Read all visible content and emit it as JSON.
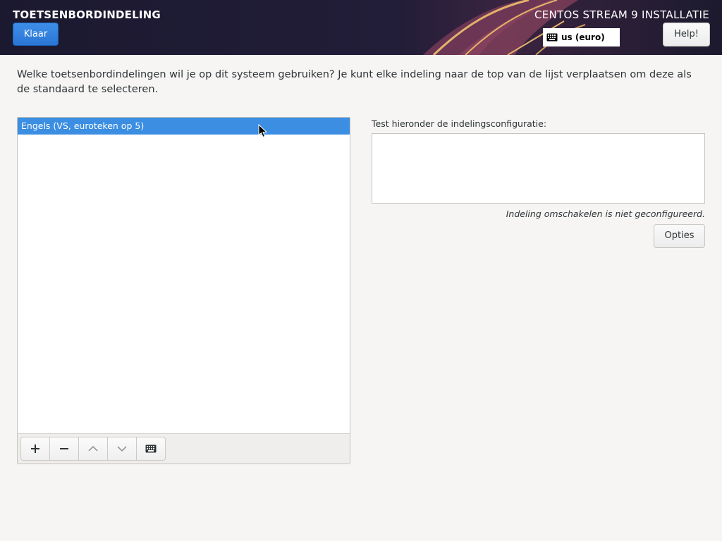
{
  "header": {
    "spoke_title": "TOETSENBORDINDELING",
    "done_label": "Klaar",
    "product_title": "CENTOS STREAM 9 INSTALLATIE",
    "layout_indicator": "us (euro)",
    "help_label": "Help!"
  },
  "description": "Welke toetsenbordindelingen wil je op dit systeem gebruiken?  Je kunt elke indeling naar de top van de lijst verplaatsen om deze als de standaard te selecteren.",
  "layouts": {
    "items": [
      {
        "label": "Engels (VS, euroteken op 5)",
        "selected": true
      }
    ]
  },
  "toolbar": {
    "buttons": [
      "add-icon",
      "remove-icon",
      "move-up-icon",
      "move-down-icon",
      "keyboard-preview-icon"
    ]
  },
  "test": {
    "label": "Test hieronder de indelingsconfiguratie:",
    "value": "",
    "switch_status": "Indeling omschakelen is niet geconfigureerd.",
    "options_label": "Opties"
  },
  "colors": {
    "accent": "#3b8ee2",
    "header_bg": "#1c1a2e",
    "background": "#f6f5f4"
  }
}
